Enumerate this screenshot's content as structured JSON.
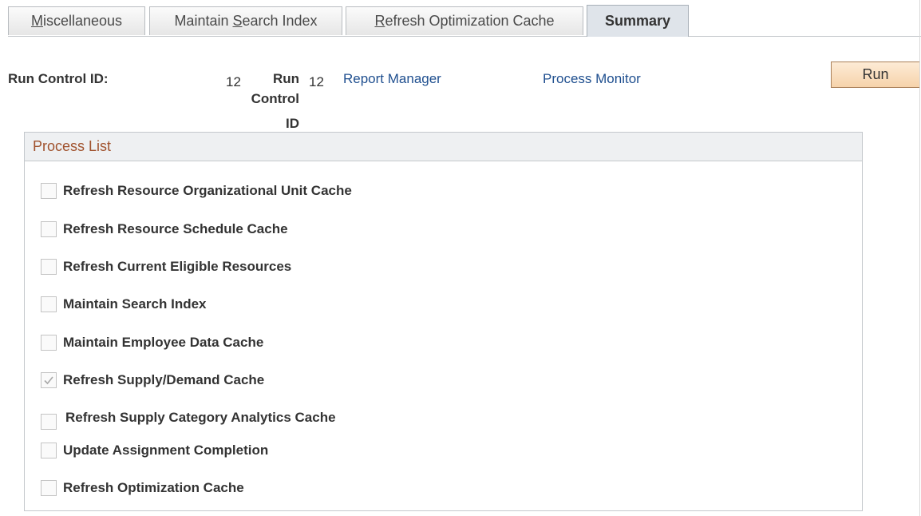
{
  "tabs": [
    {
      "prefix": "",
      "accel": "M",
      "rest": "iscellaneous",
      "active": false
    },
    {
      "prefix": "Maintain ",
      "accel": "S",
      "rest": "earch Index",
      "active": false
    },
    {
      "prefix": "",
      "accel": "R",
      "rest": "efresh Optimization Cache",
      "active": false
    },
    {
      "label": "Summary",
      "active": true
    }
  ],
  "run_control": {
    "label": "Run Control ID:",
    "value": "12",
    "label2_line1": "Run",
    "label2_line2": "Control",
    "label2_line3": "ID",
    "value2": "12",
    "report_manager": "Report Manager",
    "process_monitor": "Process Monitor",
    "run_button": "Run"
  },
  "process_list": {
    "title": "Process List",
    "items": [
      {
        "label": "Refresh Resource Organizational Unit Cache",
        "checked": false
      },
      {
        "label": "Refresh Resource Schedule Cache",
        "checked": false
      },
      {
        "label": "Refresh Current Eligible Resources",
        "checked": false
      },
      {
        "label": "Maintain Search Index",
        "checked": false
      },
      {
        "label": "Maintain Employee Data Cache",
        "checked": false
      },
      {
        "label": "Refresh Supply/Demand Cache",
        "checked": true
      },
      {
        "label": "Refresh Supply Category Analytics Cache",
        "checked": false
      },
      {
        "label": "Update Assignment Completion",
        "checked": false
      },
      {
        "label": "Refresh Optimization Cache",
        "checked": false
      }
    ]
  }
}
